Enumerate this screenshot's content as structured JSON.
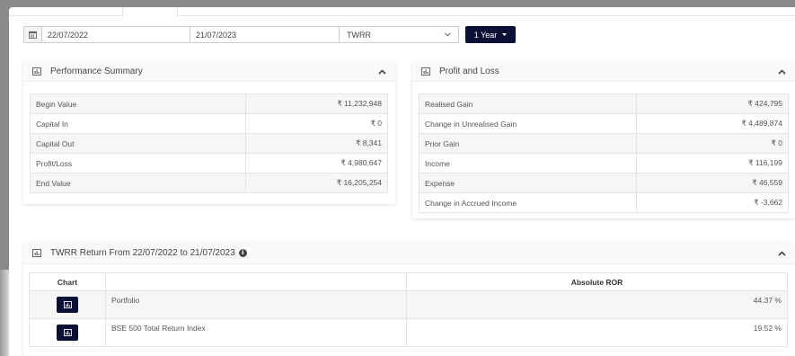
{
  "filters": {
    "from_date": "22/07/2022",
    "to_date": "21/07/2023",
    "method": "TWRR",
    "period": "1 Year"
  },
  "performance_summary": {
    "title": "Performance Summary",
    "rows": [
      {
        "label": "Begin Value",
        "value": "₹ 11,232,948"
      },
      {
        "label": "Capital In",
        "value": "₹ 0"
      },
      {
        "label": "Capital Out",
        "value": "₹ 8,341"
      },
      {
        "label": "Profit/Loss",
        "value": "₹ 4,980,647"
      },
      {
        "label": "End Value",
        "value": "₹ 16,205,254"
      }
    ]
  },
  "profit_and_loss": {
    "title": "Profit and Loss",
    "rows": [
      {
        "label": "Realised Gain",
        "value": "₹ 424,795"
      },
      {
        "label": "Change in Unrealised Gain",
        "value": "₹ 4,489,874"
      },
      {
        "label": "Prior Gain",
        "value": "₹ 0"
      },
      {
        "label": "Income",
        "value": "₹ 116,199"
      },
      {
        "label": "Expense",
        "value": "₹ 46,559"
      },
      {
        "label": "Change in Accrued Income",
        "value": "₹ -3,662"
      }
    ]
  },
  "twrr_return": {
    "title": "TWRR Return From 22/07/2022 to 21/07/2023",
    "columns": [
      "Chart",
      "",
      "Absolute ROR"
    ],
    "rows": [
      {
        "name": "Portfolio",
        "ror": "44.37 %"
      },
      {
        "name": "BSE 500 Total Return Index",
        "ror": "19.52 %"
      }
    ]
  },
  "colors": {
    "primary_dark": "#0b1035"
  }
}
